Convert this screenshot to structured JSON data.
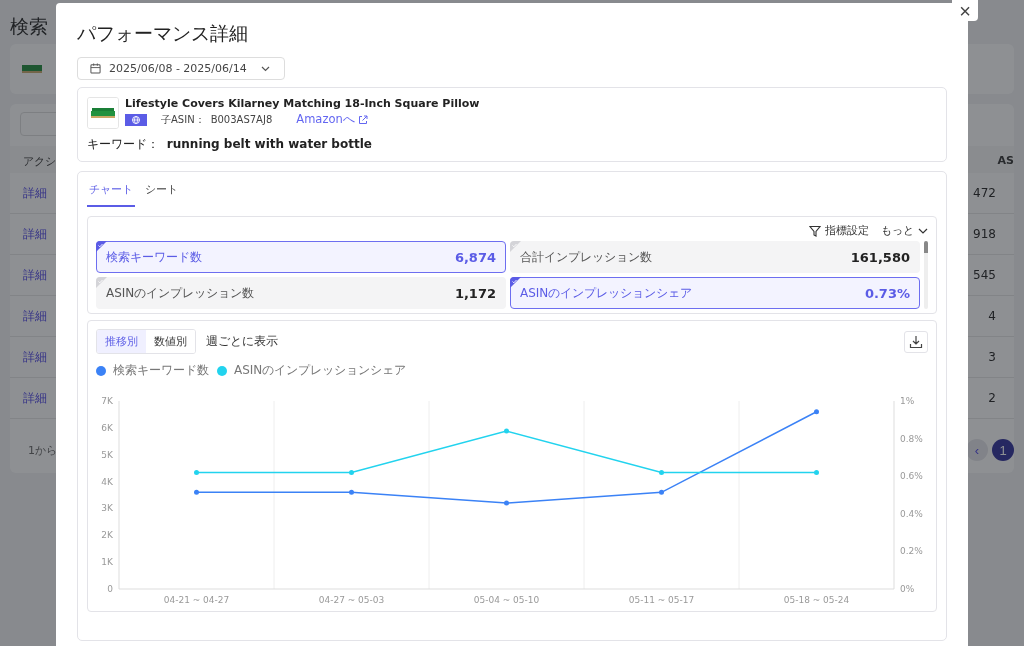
{
  "background": {
    "title": "検索",
    "table_header": {
      "action": "アクシ",
      "column_2": "AS"
    },
    "rows": [
      {
        "action": "詳細",
        "value": "472"
      },
      {
        "action": "詳細",
        "value": "918"
      },
      {
        "action": "詳細",
        "value": "545"
      },
      {
        "action": "詳細",
        "value": "4"
      },
      {
        "action": "詳細",
        "value": "3"
      },
      {
        "action": "詳細",
        "value": "2"
      }
    ],
    "footer": "1から",
    "pagination": {
      "prev": "‹",
      "current": "1"
    }
  },
  "modal": {
    "title": "パフォーマンス詳細",
    "close": "×",
    "date_range": "2025/06/08 - 2025/06/14",
    "product": {
      "name": "Lifestyle Covers Kilarney Matching 18-Inch Square Pillow",
      "asin_label": "子ASIN：",
      "asin": "B003AS7AJ8",
      "link": "Amazonへ",
      "keyword_label": "キーワード：",
      "keyword": "running belt with water bottle"
    },
    "tabs": [
      {
        "label": "チャート",
        "selected": true
      },
      {
        "label": "シート",
        "selected": false
      }
    ],
    "metric_settings": "指標設定",
    "more": "もっと",
    "metrics": [
      {
        "label": "検索キーワード数",
        "value": "6,874",
        "selected": true
      },
      {
        "label": "合計インプレッション数",
        "value": "161,580",
        "selected": false
      },
      {
        "label": "ASINのインプレッション数",
        "value": "1,172",
        "selected": false
      },
      {
        "label": "ASINのインプレッションシェア",
        "value": "0.73%",
        "selected": true
      }
    ],
    "view_toggle": [
      {
        "label": "推移別",
        "selected": true
      },
      {
        "label": "数値別",
        "selected": false
      }
    ],
    "period_label": "週ごとに表示",
    "chart_data": {
      "type": "line",
      "categories": [
        "04-21 ~ 04-27",
        "04-27 ~ 05-03",
        "05-04 ~ 05-10",
        "05-11 ~ 05-17",
        "05-18 ~ 05-24"
      ],
      "series": [
        {
          "name": "検索キーワード数",
          "color": "#3b82f6",
          "values": [
            3600,
            3600,
            3200,
            3600,
            6600
          ]
        },
        {
          "name": "ASINのインプレッションシェア",
          "color": "#22d3ee",
          "axis": "y2",
          "values": [
            0.62,
            0.62,
            0.84,
            0.62,
            0.62
          ]
        }
      ],
      "ylim": [
        0,
        7000
      ],
      "yticks": [
        {
          "value": 0,
          "label": "0"
        },
        {
          "value": 1000,
          "label": "1K"
        },
        {
          "value": 2000,
          "label": "2K"
        },
        {
          "value": 3000,
          "label": "3K"
        },
        {
          "value": 4000,
          "label": "4K"
        },
        {
          "value": 5000,
          "label": "5K"
        },
        {
          "value": 6000,
          "label": "6K"
        },
        {
          "value": 7000,
          "label": "7K"
        }
      ],
      "y2lim": [
        0,
        1
      ],
      "y2ticks": [
        {
          "value": 0,
          "label": "0%"
        },
        {
          "value": 0.2,
          "label": "0.2%"
        },
        {
          "value": 0.4,
          "label": "0.4%"
        },
        {
          "value": 0.6,
          "label": "0.6%"
        },
        {
          "value": 0.8,
          "label": "0.8%"
        },
        {
          "value": 1,
          "label": "1%"
        }
      ]
    }
  }
}
